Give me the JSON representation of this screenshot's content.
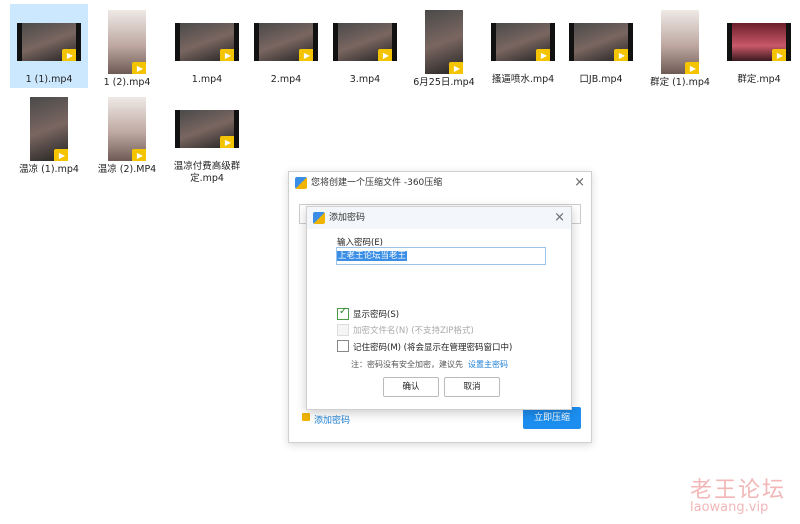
{
  "files_row1": [
    {
      "name": "1 (1).mp4",
      "thumb": "landscape",
      "selected": true
    },
    {
      "name": "1 (2).mp4",
      "thumb": "portrait-light"
    },
    {
      "name": "1.mp4",
      "thumb": "landscape"
    },
    {
      "name": "2.mp4",
      "thumb": "landscape"
    },
    {
      "name": "3.mp4",
      "thumb": "landscape"
    },
    {
      "name": "6月25日.mp4",
      "thumb": "portrait"
    },
    {
      "name": "搔逼喷水.mp4",
      "thumb": "landscape"
    },
    {
      "name": "口JB.mp4",
      "thumb": "landscape"
    },
    {
      "name": "群定 (1).mp4",
      "thumb": "portrait-light"
    },
    {
      "name": "群定.mp4",
      "thumb": "landscape-red"
    }
  ],
  "files_row2": [
    {
      "name": "温凉 (1).mp4",
      "thumb": "portrait"
    },
    {
      "name": "温凉 (2).MP4",
      "thumb": "portrait-light"
    },
    {
      "name": "温凉付费高级群定.mp4",
      "thumb": "landscape"
    }
  ],
  "badge_text": "Player",
  "outer_dialog": {
    "title": "您将创建一个压缩文件 -360压缩",
    "bottom_link": "添加密码",
    "primary_button": "立即压缩",
    "close_icon": "×"
  },
  "password_dialog": {
    "title": "添加密码",
    "input_label": "输入密码(E)",
    "input_value": "上老王论坛当老王",
    "show_password": {
      "label": "显示密码(S)",
      "checked": true
    },
    "encrypt_names": {
      "label": "加密文件名(N) (不支持ZIP格式)",
      "disabled": true
    },
    "remember_password": {
      "label": "记住密码(M) (将会显示在管理密码窗口中)",
      "checked": false
    },
    "note_prefix": "注：密码没有安全加密，建议先",
    "note_link": "设置主密码",
    "ok_button": "确认",
    "cancel_button": "取消",
    "close_icon": "×"
  },
  "watermark": {
    "cn": "老王论坛",
    "url": "laowang.vip"
  }
}
